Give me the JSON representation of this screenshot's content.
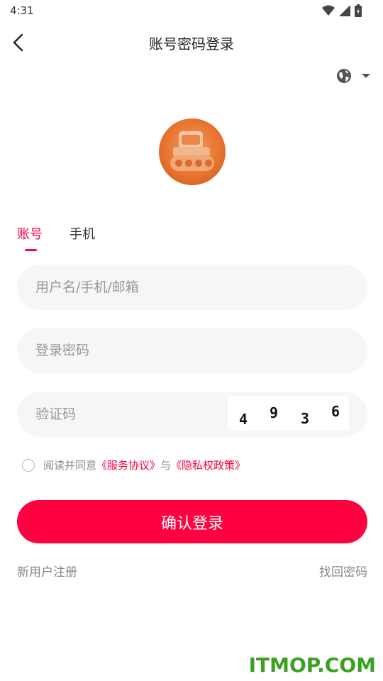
{
  "status_bar": {
    "time": "4:31"
  },
  "header": {
    "title": "账号密码登录"
  },
  "icons": {
    "back": "chevron-left-icon",
    "language": "globe-icon",
    "dropdown": "caret-down-icon"
  },
  "tabs": [
    {
      "label": "账号",
      "active": true
    },
    {
      "label": "手机",
      "active": false
    }
  ],
  "form": {
    "username_placeholder": "用户名/手机/邮箱",
    "password_placeholder": "登录密码",
    "captcha_placeholder": "验证码",
    "captcha_digits": [
      "4",
      "9",
      "3",
      "6"
    ]
  },
  "agreement": {
    "checked": false,
    "prefix": "阅读并同意",
    "terms_link": "《服务协议》",
    "conjunction": "与",
    "privacy_link": "《隐私权政策》"
  },
  "login_button": "确认登录",
  "links": {
    "register": "新用户注册",
    "forgot_password": "找回密码"
  },
  "watermark": "ITMOP.COM",
  "colors": {
    "accent": "#ff0040",
    "field_bg": "#f6f6f6",
    "watermark": "#3aa020"
  }
}
